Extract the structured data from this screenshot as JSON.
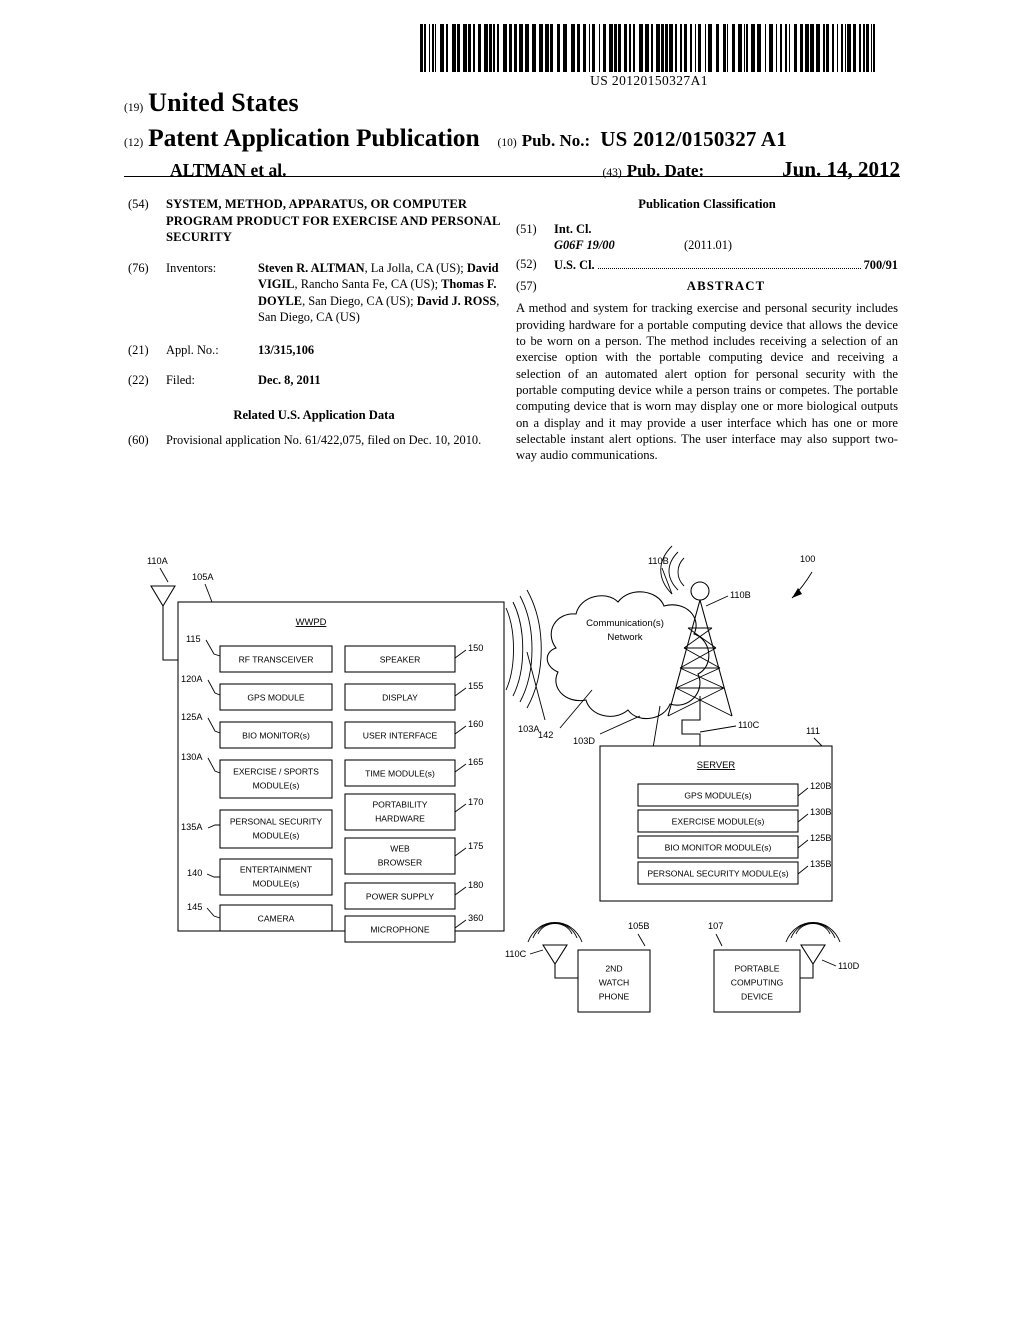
{
  "barcode": {
    "number": "US 20120150327A1"
  },
  "header": {
    "code19": "(19)",
    "country": "United States",
    "code12": "(12)",
    "doc_type": "Patent Application Publication",
    "authors": "ALTMAN et al.",
    "code10": "(10)",
    "pub_no_label": "Pub. No.:",
    "pub_no_value": "US 2012/0150327 A1",
    "code43": "(43)",
    "pub_date_label": "Pub. Date:",
    "pub_date_value": "Jun. 14, 2012"
  },
  "left_column": {
    "title_code": "(54)",
    "title": "SYSTEM, METHOD, APPARATUS, OR COMPUTER PROGRAM PRODUCT FOR EXERCISE AND PERSONAL SECURITY",
    "inventors_code": "(76)",
    "inventors_label": "Inventors:",
    "inventors": [
      {
        "name": "Steven R. ALTMAN",
        "place": ", La Jolla, CA (US); "
      },
      {
        "name": "David VIGIL",
        "place": ", Rancho Santa Fe, CA (US); "
      },
      {
        "name": "Thomas F. DOYLE",
        "place": ", San Diego, CA (US); "
      },
      {
        "name": "David J. ROSS",
        "place": ", San Diego, CA (US)"
      }
    ],
    "applno_code": "(21)",
    "applno_label": "Appl. No.:",
    "applno_value": "13/315,106",
    "filed_code": "(22)",
    "filed_label": "Filed:",
    "filed_value": "Dec. 8, 2011",
    "related_head": "Related U.S. Application Data",
    "prov_code": "(60)",
    "prov_text": "Provisional application No. 61/422,075, filed on Dec. 10, 2010."
  },
  "right_column": {
    "pub_class_head": "Publication Classification",
    "intcl_code": "(51)",
    "intcl_label": "Int. Cl.",
    "intcl_value": "G06F 19/00",
    "intcl_date": "(2011.01)",
    "uscl_code": "(52)",
    "uscl_label": "U.S. Cl.",
    "uscl_value": "700/91",
    "abstract_code": "(57)",
    "abstract_head": "ABSTRACT",
    "abstract_text": "A method and system for tracking exercise and personal security includes providing hardware for a portable computing device that allows the device to be worn on a person. The method includes receiving a selection of an exercise option with the portable computing device and receiving a selection of an automated alert option for personal security with the portable computing device while a person trains or competes. The portable computing device that is worn may display one or more biological outputs on a display and it may provide a user interface which has one or more selectable instant alert options. The user interface may also support two-way audio communications."
  },
  "figure": {
    "system_ref": "100",
    "wwpd": {
      "title": "WWPD",
      "box_ref": "105A",
      "antenna_ref": "110A",
      "left_modules": [
        {
          "ref": "115",
          "label": "RF TRANSCEIVER"
        },
        {
          "ref": "120A",
          "label": "GPS MODULE"
        },
        {
          "ref": "125A",
          "label": "BIO MONITOR(s)"
        },
        {
          "ref": "130A",
          "label": "EXERCISE / SPORTS MODULE(s)"
        },
        {
          "ref": "135A",
          "label": "PERSONAL SECURITY MODULE(s)"
        },
        {
          "ref": "140",
          "label": "ENTERTAINMENT MODULE(s)"
        },
        {
          "ref": "145",
          "label": "CAMERA"
        }
      ],
      "right_modules": [
        {
          "ref": "150",
          "label": "SPEAKER"
        },
        {
          "ref": "155",
          "label": "DISPLAY"
        },
        {
          "ref": "160",
          "label": "USER INTERFACE"
        },
        {
          "ref": "165",
          "label": "TIME MODULE(s)"
        },
        {
          "ref": "170",
          "label": "PORTABILITY HARDWARE"
        },
        {
          "ref": "175",
          "label": "WEB BROWSER"
        },
        {
          "ref": "180",
          "label": "POWER SUPPLY"
        },
        {
          "ref": "360",
          "label": "MICROPHONE"
        }
      ]
    },
    "network": {
      "line1": "Communication(s)",
      "line2": "Network",
      "cloud_ref": "142",
      "link_wwpd_ref": "103A",
      "link_server_ref": "103D",
      "tower_top_ref": "110B",
      "tower_side_ref": "110B",
      "tower_base_ref": "110C"
    },
    "server": {
      "title": "SERVER",
      "box_ref": "111",
      "modules": [
        {
          "ref": "120B",
          "label": "GPS MODULE(s)"
        },
        {
          "ref": "130B",
          "label": "EXERCISE MODULE(s)"
        },
        {
          "ref": "125B",
          "label": "BIO MONITOR MODULE(s)"
        },
        {
          "ref": "135B",
          "label": "PERSONAL SECURITY MODULE(s)"
        }
      ]
    },
    "devices": [
      {
        "ref": "105B",
        "antenna_ref": "110C",
        "lines": [
          "2ND",
          "WATCH",
          "PHONE"
        ]
      },
      {
        "ref": "107",
        "antenna_ref": "110D",
        "lines": [
          "PORTABLE",
          "COMPUTING",
          "DEVICE"
        ]
      }
    ]
  }
}
